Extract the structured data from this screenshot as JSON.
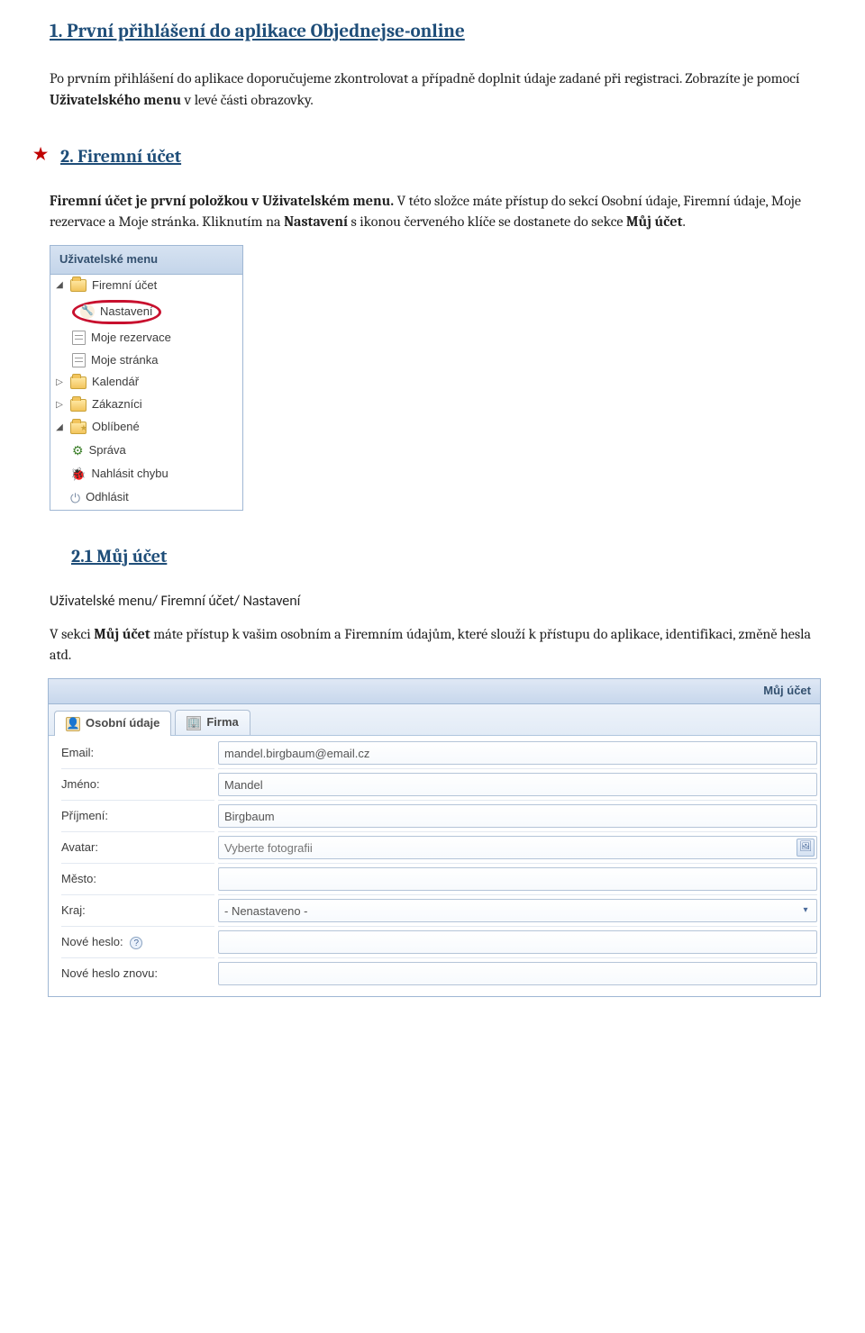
{
  "sec1": {
    "title": "1. První přihlášení do aplikace Objednejse-online",
    "p1a": "Po prvním přihlášení do aplikace doporučujeme zkontrolovat a případně doplnit údaje zadané při registraci. Zobrazíte je pomocí ",
    "p1b": "Uživatelského menu",
    "p1c": " v levé části obrazovky."
  },
  "sec2": {
    "title": "2. Firemní účet",
    "p1a": "Firemní účet je první položkou v Uživatelském menu.",
    "p1b": " V této složce máte přístup do sekcí Osobní údaje, Firemní údaje, Moje rezervace a Moje stránka. Kliknutím na ",
    "p1c": "Nastavení",
    "p1d": " s ikonou červeného klíče se dostanete do sekce ",
    "p1e": "Můj účet",
    "p1f": "."
  },
  "usermenu": {
    "title": "Uživatelské menu",
    "items": [
      "Firemní účet",
      "Nastavení",
      "Moje rezervace",
      "Moje stránka",
      "Kalendář",
      "Zákazníci",
      "Oblíbené",
      "Správa",
      "Nahlásit chybu",
      "Odhlásit"
    ]
  },
  "sec21": {
    "title": "2.1 Můj účet",
    "breadcrumb": "Uživatelské menu/ Firemní účet/ Nastavení",
    "p1a": "V  sekci ",
    "p1b": "Můj účet",
    "p1c": " máte přístup k vašim osobním a Firemním údajům, které slouží k přístupu do aplikace, identifikaci, změně hesla atd."
  },
  "account": {
    "panel_title": "Můj účet",
    "tabs": {
      "t0": "Osobní údaje",
      "t1": "Firma"
    },
    "labels": {
      "email": "Email:",
      "jmeno": "Jméno:",
      "prijmeni": "Příjmení:",
      "avatar": "Avatar:",
      "mesto": "Město:",
      "kraj": "Kraj:",
      "heslo1_a": "Nové heslo:",
      "heslo2": "Nové heslo znovu:"
    },
    "values": {
      "email": "mandel.birgbaum@email.cz",
      "jmeno": "Mandel",
      "prijmeni": "Birgbaum",
      "avatar_placeholder": "Vyberte fotografii",
      "mesto": "",
      "kraj": "- Nenastaveno -",
      "heslo1": "",
      "heslo2": ""
    }
  }
}
